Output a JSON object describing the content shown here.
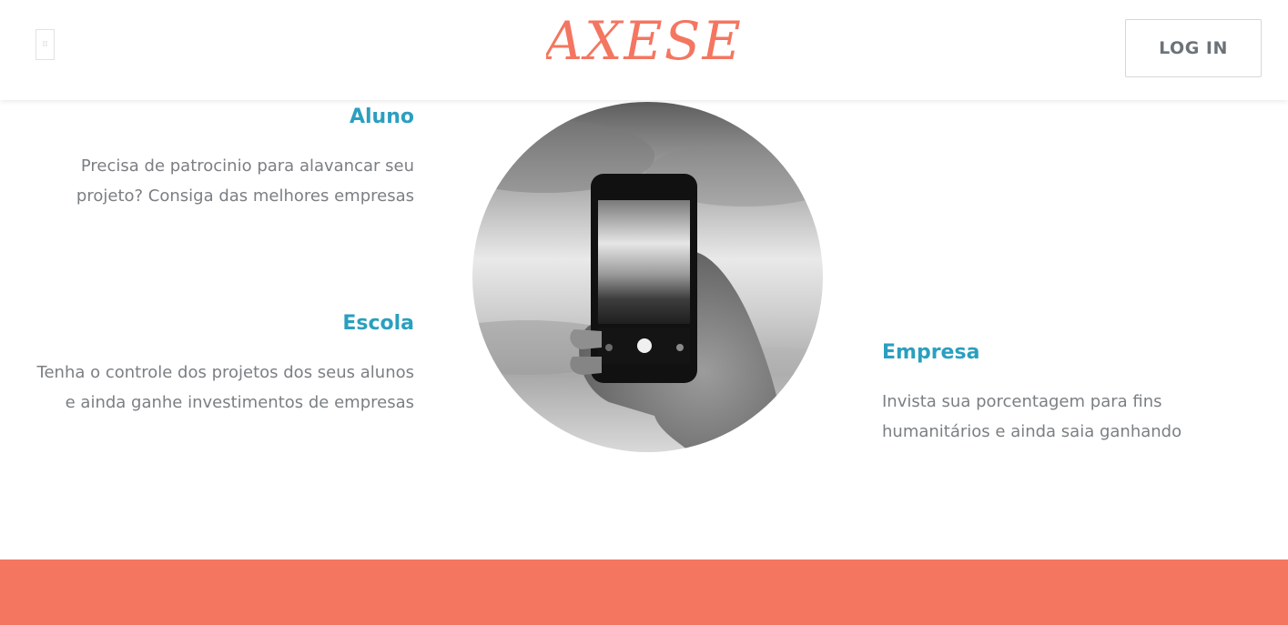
{
  "header": {
    "logo_text": "AXESE",
    "login_label": "LOG IN",
    "menu_icon": "menu-icon"
  },
  "features": {
    "aluno": {
      "title": "Aluno",
      "description": "Precisa de patrocinio para alavancar seu projeto? Consiga das melhores empresas"
    },
    "escola": {
      "title": "Escola",
      "description": "Tenha o controle dos projetos dos seus alunos e ainda ganhe investimentos de empresas"
    },
    "empresa": {
      "title": "Empresa",
      "description": "Invista sua porcentagem para fins humanitários e ainda saia ganhando"
    }
  },
  "image": {
    "description": "hand-holding-smartphone-photo"
  },
  "colors": {
    "brand": "#f47660",
    "heading": "#2b9fbf",
    "body_text": "#7b7f83"
  }
}
